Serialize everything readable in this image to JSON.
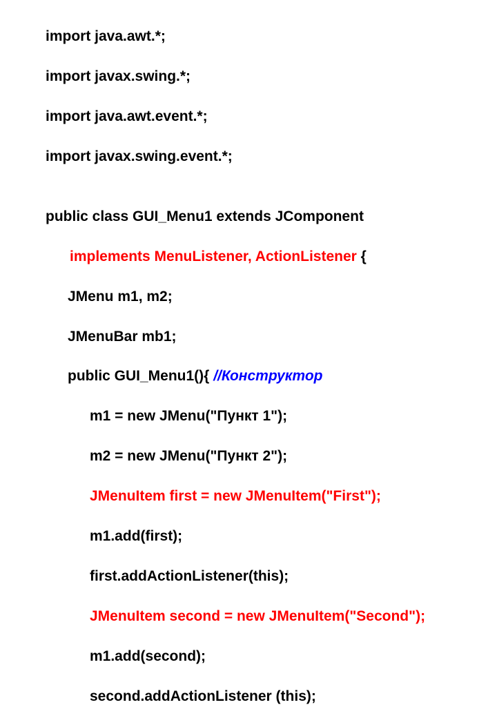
{
  "code": {
    "l1": "import java.awt.*;",
    "l2": "import javax.swing.*;",
    "l3": "import java.awt.event.*;",
    "l4": "import javax.swing.event.*;",
    "l5": "",
    "l6": "public class GUI_Menu1 extends JComponent",
    "l7a": "      ",
    "l7b": "implements MenuListener, ActionListener",
    "l7c": " {",
    "l8": "JMenu m1, m2;",
    "l9": "JMenuBar mb1;",
    "l10a": "public GUI_Menu1(){ ",
    "l10b": "//Конструктор",
    "l11": "m1 = new JMenu(\"Пункт 1\");",
    "l12": "m2 = new JMenu(\"Пункт 2\");",
    "l13": "JMenuItem first = new JMenuItem(\"First\");",
    "l14": "m1.add(first);",
    "l15": "first.addActionListener(this);",
    "l16": "JMenuItem second = new JMenuItem(\"Second\");",
    "l17": "m1.add(second);",
    "l18": "second.addActionListener (this);"
  }
}
